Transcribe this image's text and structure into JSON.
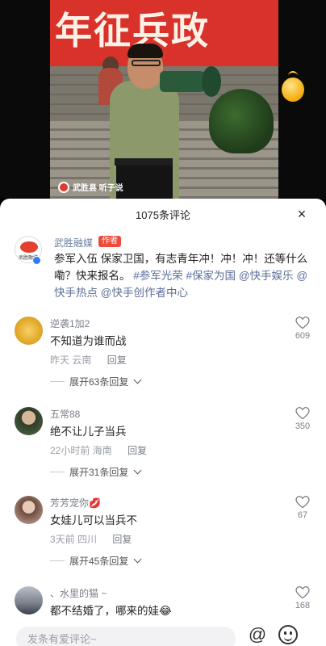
{
  "video": {
    "banner_text": "年征兵政",
    "watermark": "武胜县  听子说"
  },
  "comments_panel": {
    "title": "1075条评论",
    "close_label": "×"
  },
  "post": {
    "author": "武胜融媒",
    "author_badge": "作者",
    "avatar_text": "武胜融媒",
    "text_plain": "参军入伍 保家卫国，有志青年冲！冲！冲！还等什么嘞？快来报名。",
    "tags": [
      "#参军光荣",
      "#保家为国",
      "@快手娱乐",
      "@快手热点",
      "@快手创作者中心"
    ]
  },
  "comments": [
    {
      "name": "逆袭1加2",
      "text": "不知道为谁而战",
      "time": "昨天",
      "location": "云南",
      "reply": "回复",
      "likes": "609",
      "expand": "展开63条回复"
    },
    {
      "name": "五常88",
      "text": "绝不让儿子当兵",
      "time": "22小时前",
      "location": "海南",
      "reply": "回复",
      "likes": "350",
      "expand": "展开31条回复"
    },
    {
      "name": "芳芳宠你💋",
      "text": "女娃儿可以当兵不",
      "time": "3天前",
      "location": "四川",
      "reply": "回复",
      "likes": "67",
      "expand": "展开45条回复"
    },
    {
      "name": "、水里的猫 ~",
      "text": "都不结婚了，哪来的娃😂",
      "likes": "168"
    }
  ],
  "input": {
    "placeholder": "发条有爱评论~"
  },
  "colors": {
    "banner_red": "#d8322b",
    "author_badge": "#f04b3a",
    "link_blue": "#5c6f9a",
    "verified_blue": "#2f7cf6"
  }
}
